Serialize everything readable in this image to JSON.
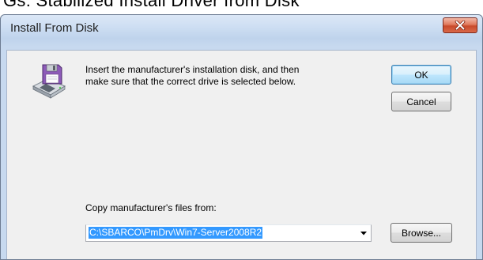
{
  "background_snippet": "Gs: Stabilized Install Driver from Disk",
  "dialog": {
    "title": "Install From Disk",
    "message_line1": "Insert the manufacturer's installation disk, and then",
    "message_line2": "make sure that the correct drive is selected below.",
    "ok_label": "OK",
    "cancel_label": "Cancel",
    "copy_label": "Copy manufacturer's files from:",
    "path_value": "C:\\SBARCO\\PmDrv\\Win7-Server2008R2",
    "browse_label": "Browse..."
  },
  "icons": {
    "close": "close-icon",
    "disk": "floppy-disk-drive-icon",
    "dropdown": "chevron-down-icon"
  },
  "colors": {
    "selection": "#3399ff",
    "close_button": "#c94a2b",
    "default_button_border": "#3c7fb1"
  }
}
